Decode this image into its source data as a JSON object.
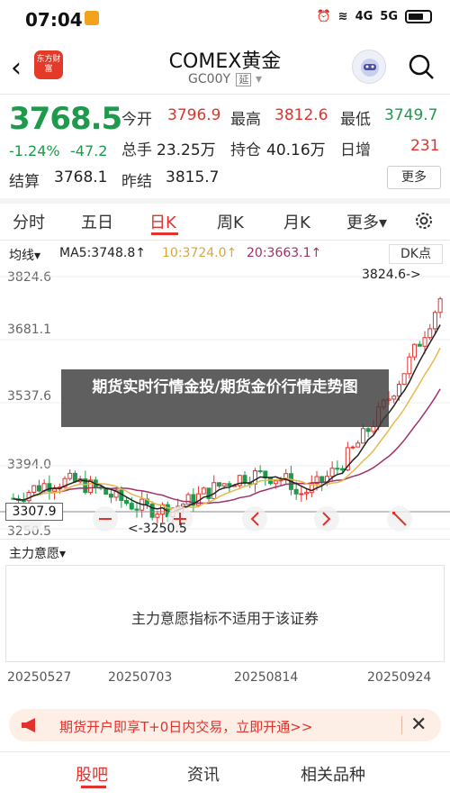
{
  "status_bar": {
    "time": "07:04",
    "network_1": "4G",
    "network_2": "5G"
  },
  "header": {
    "logo_text": "东方财富",
    "title": "COMEX黄金",
    "subtitle": "GC00Y",
    "subtitle_badge": "延",
    "back_icon": "chevron-left-icon",
    "search_icon": "search-icon"
  },
  "quote": {
    "price": "3768.5",
    "change_pct": "-1.24%",
    "change_abs": "-47.2",
    "open_label": "今开",
    "open": "3796.9",
    "high_label": "最高",
    "high": "3812.6",
    "low_label": "最低",
    "low": "3749.7",
    "volume_label": "总手",
    "volume": "23.25万",
    "position_label": "持仓",
    "position": "40.16万",
    "daily_inc_label": "日增",
    "daily_inc": "231",
    "settle_label": "结算",
    "settle": "3768.1",
    "prev_settle_label": "昨结",
    "prev_settle": "3815.7",
    "more_label": "更多"
  },
  "tabs": [
    {
      "label": "分时",
      "active": false
    },
    {
      "label": "五日",
      "active": false
    },
    {
      "label": "日K",
      "active": true
    },
    {
      "label": "周K",
      "active": false
    },
    {
      "label": "月K",
      "active": false
    },
    {
      "label": "更多▾",
      "active": false
    }
  ],
  "chart": {
    "line_select": "均线▾",
    "ma5": "MA5:3748.8↑",
    "ma10": "10:3724.0↑",
    "ma20": "20:3663.1↑",
    "dk_label": "DK点",
    "y_ticks": [
      "3824.6",
      "3681.1",
      "3537.6",
      "3394.0",
      "3250.5"
    ],
    "crosshair_value": "3307.9",
    "high_marker": "3824.6->",
    "low_marker": "<-3250.5",
    "colors": {
      "up": "#e0332d",
      "down": "#1f9a4c",
      "ma5": "#222222",
      "ma10": "#e8b84a",
      "ma20": "#a0306a"
    }
  },
  "chart_data": {
    "type": "candlestick",
    "x_start": "20250527",
    "x_end": "20250924",
    "ylim": [
      3250.5,
      3824.6
    ],
    "high": 3824.6,
    "low": 3250.5,
    "x_tick_labels": [
      "20250527",
      "20250703",
      "20250814",
      "20250924"
    ]
  },
  "indicator": {
    "select_label": "主力意愿▾",
    "message": "主力意愿指标不适用于该证券"
  },
  "dates": [
    "20250527",
    "20250703",
    "20250814",
    "20250924"
  ],
  "banner": {
    "text": "期货开户即享T+0日内交易，立即开通>>",
    "close": "✕"
  },
  "overlay": {
    "caption": "期货实时行情金投/期货金价行情走势图",
    "watermark": "东方财富"
  },
  "bottom_nav": [
    {
      "label": "股吧",
      "active": true
    },
    {
      "label": "资讯",
      "active": false
    },
    {
      "label": "相关品种",
      "active": false
    }
  ]
}
